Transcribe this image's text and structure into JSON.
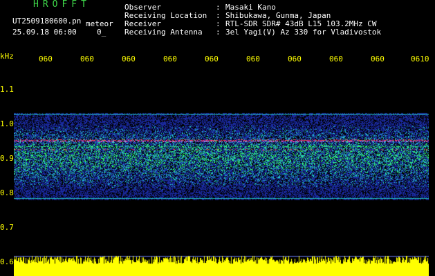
{
  "header": {
    "app_title": "HROFFT",
    "file_name": "UT2509180600.pn",
    "mode": "meteor",
    "datetime": "25.09.18 06:00",
    "counter": "0_",
    "info": [
      {
        "key": "Observer",
        "value": "Masaki Kano"
      },
      {
        "key": "Receiving Location",
        "value": "Shibukawa, Gunma, Japan"
      },
      {
        "key": "Receiver",
        "value": "RTL-SDR SDR# 43dB L15 103.2MHz CW"
      },
      {
        "key": "Receiving Antenna",
        "value": "3el Yagi(V) Az 330 for Vladivostok"
      }
    ]
  },
  "axes": {
    "y_unit": "kHz",
    "y_ticks": [
      "1.1",
      "1.0",
      "0.9",
      "0.8",
      "0.7",
      "0.6"
    ],
    "x_ticks": [
      "060",
      "060",
      "060",
      "060",
      "060",
      "060",
      "060",
      "060",
      "060",
      "0610"
    ]
  },
  "colors": {
    "title": "#3fd94a",
    "label": "#ffff00",
    "text": "#ffffff",
    "background": "#000000",
    "noise_low": "#1a2aa0",
    "noise_mid": "#22c8c8",
    "noise_high": "#33ff66",
    "signal": "#ff3355",
    "signal_core": "#ff66ff",
    "echo_bar": "#ffff00"
  }
}
